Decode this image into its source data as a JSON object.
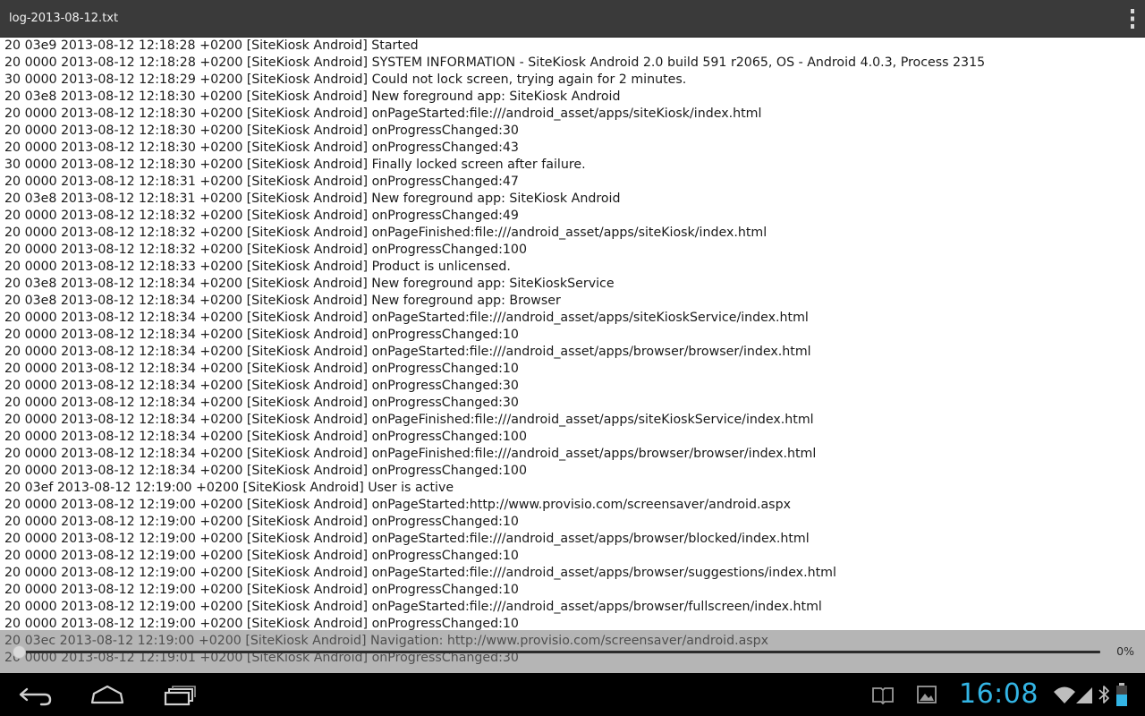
{
  "window": {
    "title": "log-2013-08-12.txt"
  },
  "log_lines": [
    "20 03e9 2013-08-12 12:18:28 +0200 [SiteKiosk Android] Started",
    "20 0000 2013-08-12 12:18:28 +0200 [SiteKiosk Android] SYSTEM INFORMATION - SiteKiosk Android 2.0 build 591 r2065, OS - Android 4.0.3, Process 2315",
    "30 0000 2013-08-12 12:18:29 +0200 [SiteKiosk Android] Could not lock screen, trying again for 2 minutes.",
    "20 03e8 2013-08-12 12:18:30 +0200 [SiteKiosk Android] New foreground app: SiteKiosk Android",
    "20 0000 2013-08-12 12:18:30 +0200 [SiteKiosk Android] onPageStarted:file:///android_asset/apps/siteKiosk/index.html",
    "20 0000 2013-08-12 12:18:30 +0200 [SiteKiosk Android] onProgressChanged:30",
    "20 0000 2013-08-12 12:18:30 +0200 [SiteKiosk Android] onProgressChanged:43",
    "30 0000 2013-08-12 12:18:30 +0200 [SiteKiosk Android] Finally locked screen after failure.",
    "20 0000 2013-08-12 12:18:31 +0200 [SiteKiosk Android] onProgressChanged:47",
    "20 03e8 2013-08-12 12:18:31 +0200 [SiteKiosk Android] New foreground app: SiteKiosk Android",
    "20 0000 2013-08-12 12:18:32 +0200 [SiteKiosk Android] onProgressChanged:49",
    "20 0000 2013-08-12 12:18:32 +0200 [SiteKiosk Android] onPageFinished:file:///android_asset/apps/siteKiosk/index.html",
    "20 0000 2013-08-12 12:18:32 +0200 [SiteKiosk Android] onProgressChanged:100",
    "20 0000 2013-08-12 12:18:33 +0200 [SiteKiosk Android] Product is unlicensed.",
    "20 03e8 2013-08-12 12:18:34 +0200 [SiteKiosk Android] New foreground app: SiteKioskService",
    "20 03e8 2013-08-12 12:18:34 +0200 [SiteKiosk Android] New foreground app: Browser",
    "20 0000 2013-08-12 12:18:34 +0200 [SiteKiosk Android] onPageStarted:file:///android_asset/apps/siteKioskService/index.html",
    "20 0000 2013-08-12 12:18:34 +0200 [SiteKiosk Android] onProgressChanged:10",
    "20 0000 2013-08-12 12:18:34 +0200 [SiteKiosk Android] onPageStarted:file:///android_asset/apps/browser/browser/index.html",
    "20 0000 2013-08-12 12:18:34 +0200 [SiteKiosk Android] onProgressChanged:10",
    "20 0000 2013-08-12 12:18:34 +0200 [SiteKiosk Android] onProgressChanged:30",
    "20 0000 2013-08-12 12:18:34 +0200 [SiteKiosk Android] onProgressChanged:30",
    "20 0000 2013-08-12 12:18:34 +0200 [SiteKiosk Android] onPageFinished:file:///android_asset/apps/siteKioskService/index.html",
    "20 0000 2013-08-12 12:18:34 +0200 [SiteKiosk Android] onProgressChanged:100",
    "20 0000 2013-08-12 12:18:34 +0200 [SiteKiosk Android] onPageFinished:file:///android_asset/apps/browser/browser/index.html",
    "20 0000 2013-08-12 12:18:34 +0200 [SiteKiosk Android] onProgressChanged:100",
    "20 03ef 2013-08-12 12:19:00 +0200 [SiteKiosk Android] User is active",
    "20 0000 2013-08-12 12:19:00 +0200 [SiteKiosk Android] onPageStarted:http://www.provisio.com/screensaver/android.aspx",
    "20 0000 2013-08-12 12:19:00 +0200 [SiteKiosk Android] onProgressChanged:10",
    "20 0000 2013-08-12 12:19:00 +0200 [SiteKiosk Android] onPageStarted:file:///android_asset/apps/browser/blocked/index.html",
    "20 0000 2013-08-12 12:19:00 +0200 [SiteKiosk Android] onProgressChanged:10",
    "20 0000 2013-08-12 12:19:00 +0200 [SiteKiosk Android] onPageStarted:file:///android_asset/apps/browser/suggestions/index.html",
    "20 0000 2013-08-12 12:19:00 +0200 [SiteKiosk Android] onProgressChanged:10",
    "20 0000 2013-08-12 12:19:00 +0200 [SiteKiosk Android] onPageStarted:file:///android_asset/apps/browser/fullscreen/index.html",
    "20 0000 2013-08-12 12:19:00 +0200 [SiteKiosk Android] onProgressChanged:10",
    "20 03ec 2013-08-12 12:19:00 +0200 [SiteKiosk Android] Navigation: http://www.provisio.com/screensaver/android.aspx",
    "20 0000 2013-08-12 12:19:01 +0200 [SiteKiosk Android] onProgressChanged:30"
  ],
  "scroll_indicator": {
    "percent_label": "0%",
    "position_fraction": 0.0
  },
  "nav_bar": {
    "icons": [
      "back-icon",
      "home-icon",
      "recent-apps-icon"
    ]
  },
  "status_bar": {
    "clock": "16:08",
    "icons": [
      "book-icon",
      "gallery-icon",
      "wifi-icon",
      "signal-icon",
      "bluetooth-icon",
      "battery-icon"
    ],
    "clock_color": "#33b5e5"
  },
  "colors": {
    "action_bar": "#3a3a3a",
    "log_text": "#1a1a1a",
    "nav_bar": "#000000"
  }
}
